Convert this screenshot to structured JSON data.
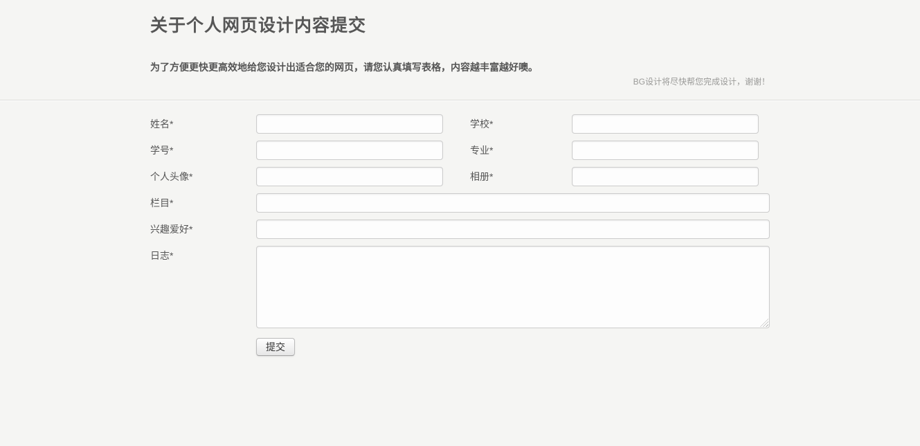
{
  "page": {
    "title": "关于个人网页设计内容提交",
    "description": "为了方便更快更高效地给您设计出适合您的网页，请您认真填写表格，内容越丰富越好噢。",
    "note": "BG设计将尽快帮您完成设计，谢谢！"
  },
  "form": {
    "fields": {
      "name": {
        "label": "姓名*",
        "value": ""
      },
      "school": {
        "label": "学校*",
        "value": ""
      },
      "student_id": {
        "label": "学号*",
        "value": ""
      },
      "major": {
        "label": "专业*",
        "value": ""
      },
      "avatar": {
        "label": "个人头像*",
        "value": ""
      },
      "album": {
        "label": "相册*",
        "value": ""
      },
      "columns": {
        "label": "栏目*",
        "value": ""
      },
      "hobbies": {
        "label": "兴趣爱好*",
        "value": ""
      },
      "journal": {
        "label": "日志*",
        "value": ""
      }
    },
    "submit_label": "提交"
  },
  "colors": {
    "page_background": "#f5f5f3",
    "divider": "#dcdcda",
    "title_text": "#565656",
    "label_text": "#555555",
    "note_text": "#9a9a98",
    "input_background": "#fdfdfd",
    "input_border": "#cccccc",
    "button_text": "#333333",
    "button_border": "#bbbbbb",
    "button_gradient_top": "#ffffff",
    "button_gradient_bottom": "#e6e6e6"
  }
}
